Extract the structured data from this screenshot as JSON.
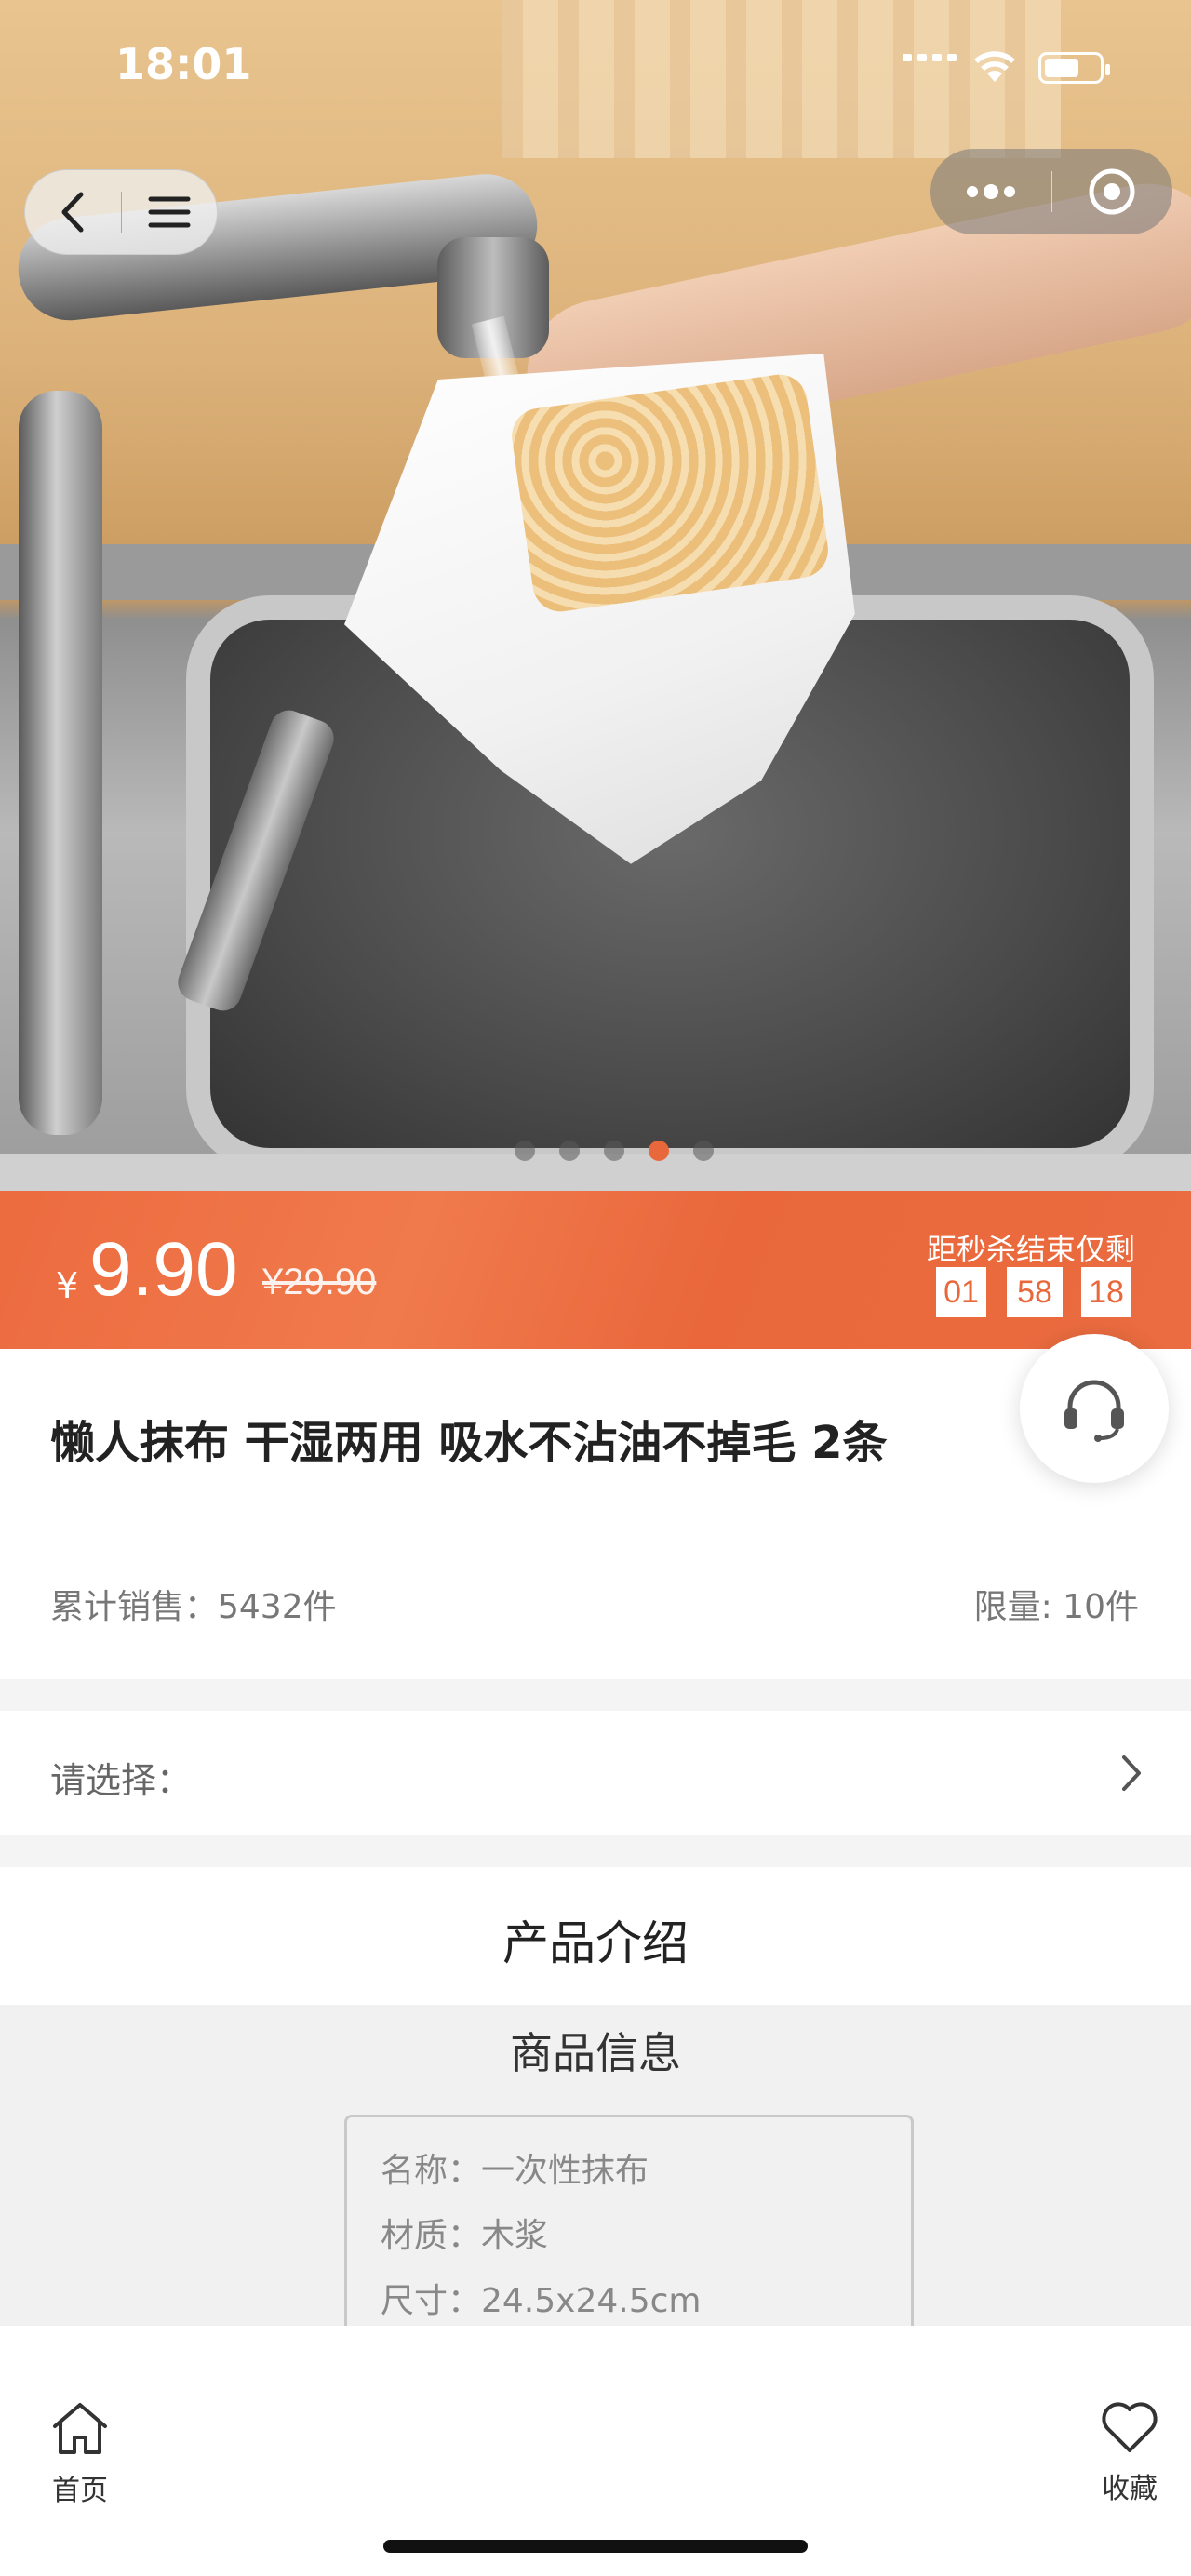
{
  "status_bar": {
    "time": "18:01"
  },
  "carousel": {
    "dot_count": 5,
    "active_index": 3
  },
  "price_bar": {
    "currency": "¥",
    "price": "9.90",
    "original_price": "¥29.90",
    "countdown_label": "距秒杀结束仅剩",
    "hours": "01",
    "minutes": "58",
    "seconds": "18",
    "accent_color": "#EA6B3E"
  },
  "product": {
    "title": "懒人抹布 干湿两用 吸水不沾油不掉毛 2条",
    "sales": "累计销售：5432件",
    "limit": "限量: 10件"
  },
  "select": {
    "label": "请选择："
  },
  "intro": {
    "label": "产品介绍"
  },
  "details": {
    "heading": "商品信息",
    "rows": [
      "名称：一次性抹布",
      "材质：木浆",
      "尺寸：24.5x24.5cm"
    ]
  },
  "tabbar": {
    "home_label": "首页",
    "favorite_label": "收藏"
  },
  "icons": {
    "back": "chevron-left-icon",
    "menu": "menu-icon",
    "more": "more-dots-icon",
    "close": "target-icon",
    "service": "headset-icon",
    "chevron": "chevron-right-icon",
    "home": "home-icon",
    "favorite": "heart-icon"
  }
}
